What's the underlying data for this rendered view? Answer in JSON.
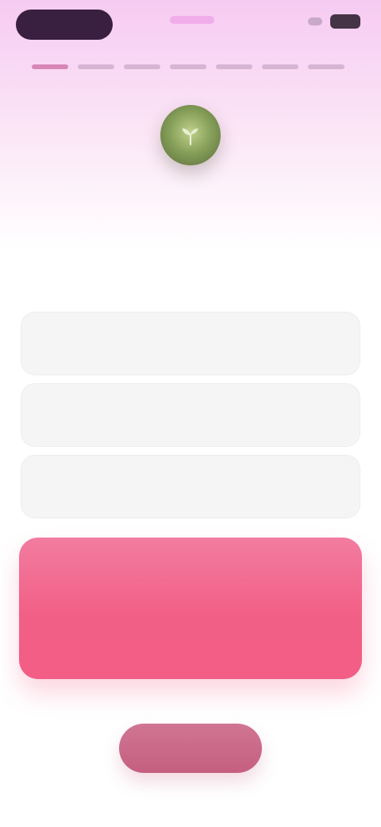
{
  "colors": {
    "accent": "#f25f86",
    "option_bg": "#f6f5f6",
    "bottom_button": "#c55f80",
    "header_gradient_top": "#f6cbf2"
  },
  "question": {
    "text": ""
  },
  "options": [
    {
      "label": "",
      "emoji": ""
    },
    {
      "label": "",
      "emoji": ""
    },
    {
      "label": "",
      "emoji": ""
    }
  ],
  "selected_option": {
    "title": "",
    "emoji": "",
    "subtitle": ""
  },
  "bottom_button": {
    "label": ""
  },
  "icons": {
    "badge": "seedling-icon"
  }
}
